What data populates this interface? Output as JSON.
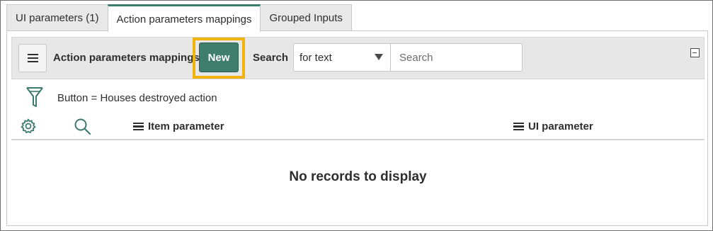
{
  "tabs": [
    {
      "label": "UI parameters (1)",
      "active": false
    },
    {
      "label": "Action parameters mappings",
      "active": true
    },
    {
      "label": "Grouped Inputs",
      "active": false
    }
  ],
  "toolbar": {
    "list_title": "Action parameters mappings",
    "new_label": "New",
    "search_label": "Search",
    "search_field_selected": "for text",
    "search_placeholder": "Search",
    "menu_icon": "hamburger-icon",
    "collapse_icon": "collapse-icon",
    "highlight_color": "#f1b20b",
    "new_button_color": "#3f7e6b"
  },
  "filter": {
    "icon": "funnel-icon",
    "text": "Button = Houses destroyed action"
  },
  "table": {
    "header_icons": [
      "gear-icon",
      "search-icon"
    ],
    "columns": [
      "Item parameter",
      "UI parameter"
    ],
    "empty_message": "No records to display",
    "icon_color": "#3d7a6e"
  }
}
